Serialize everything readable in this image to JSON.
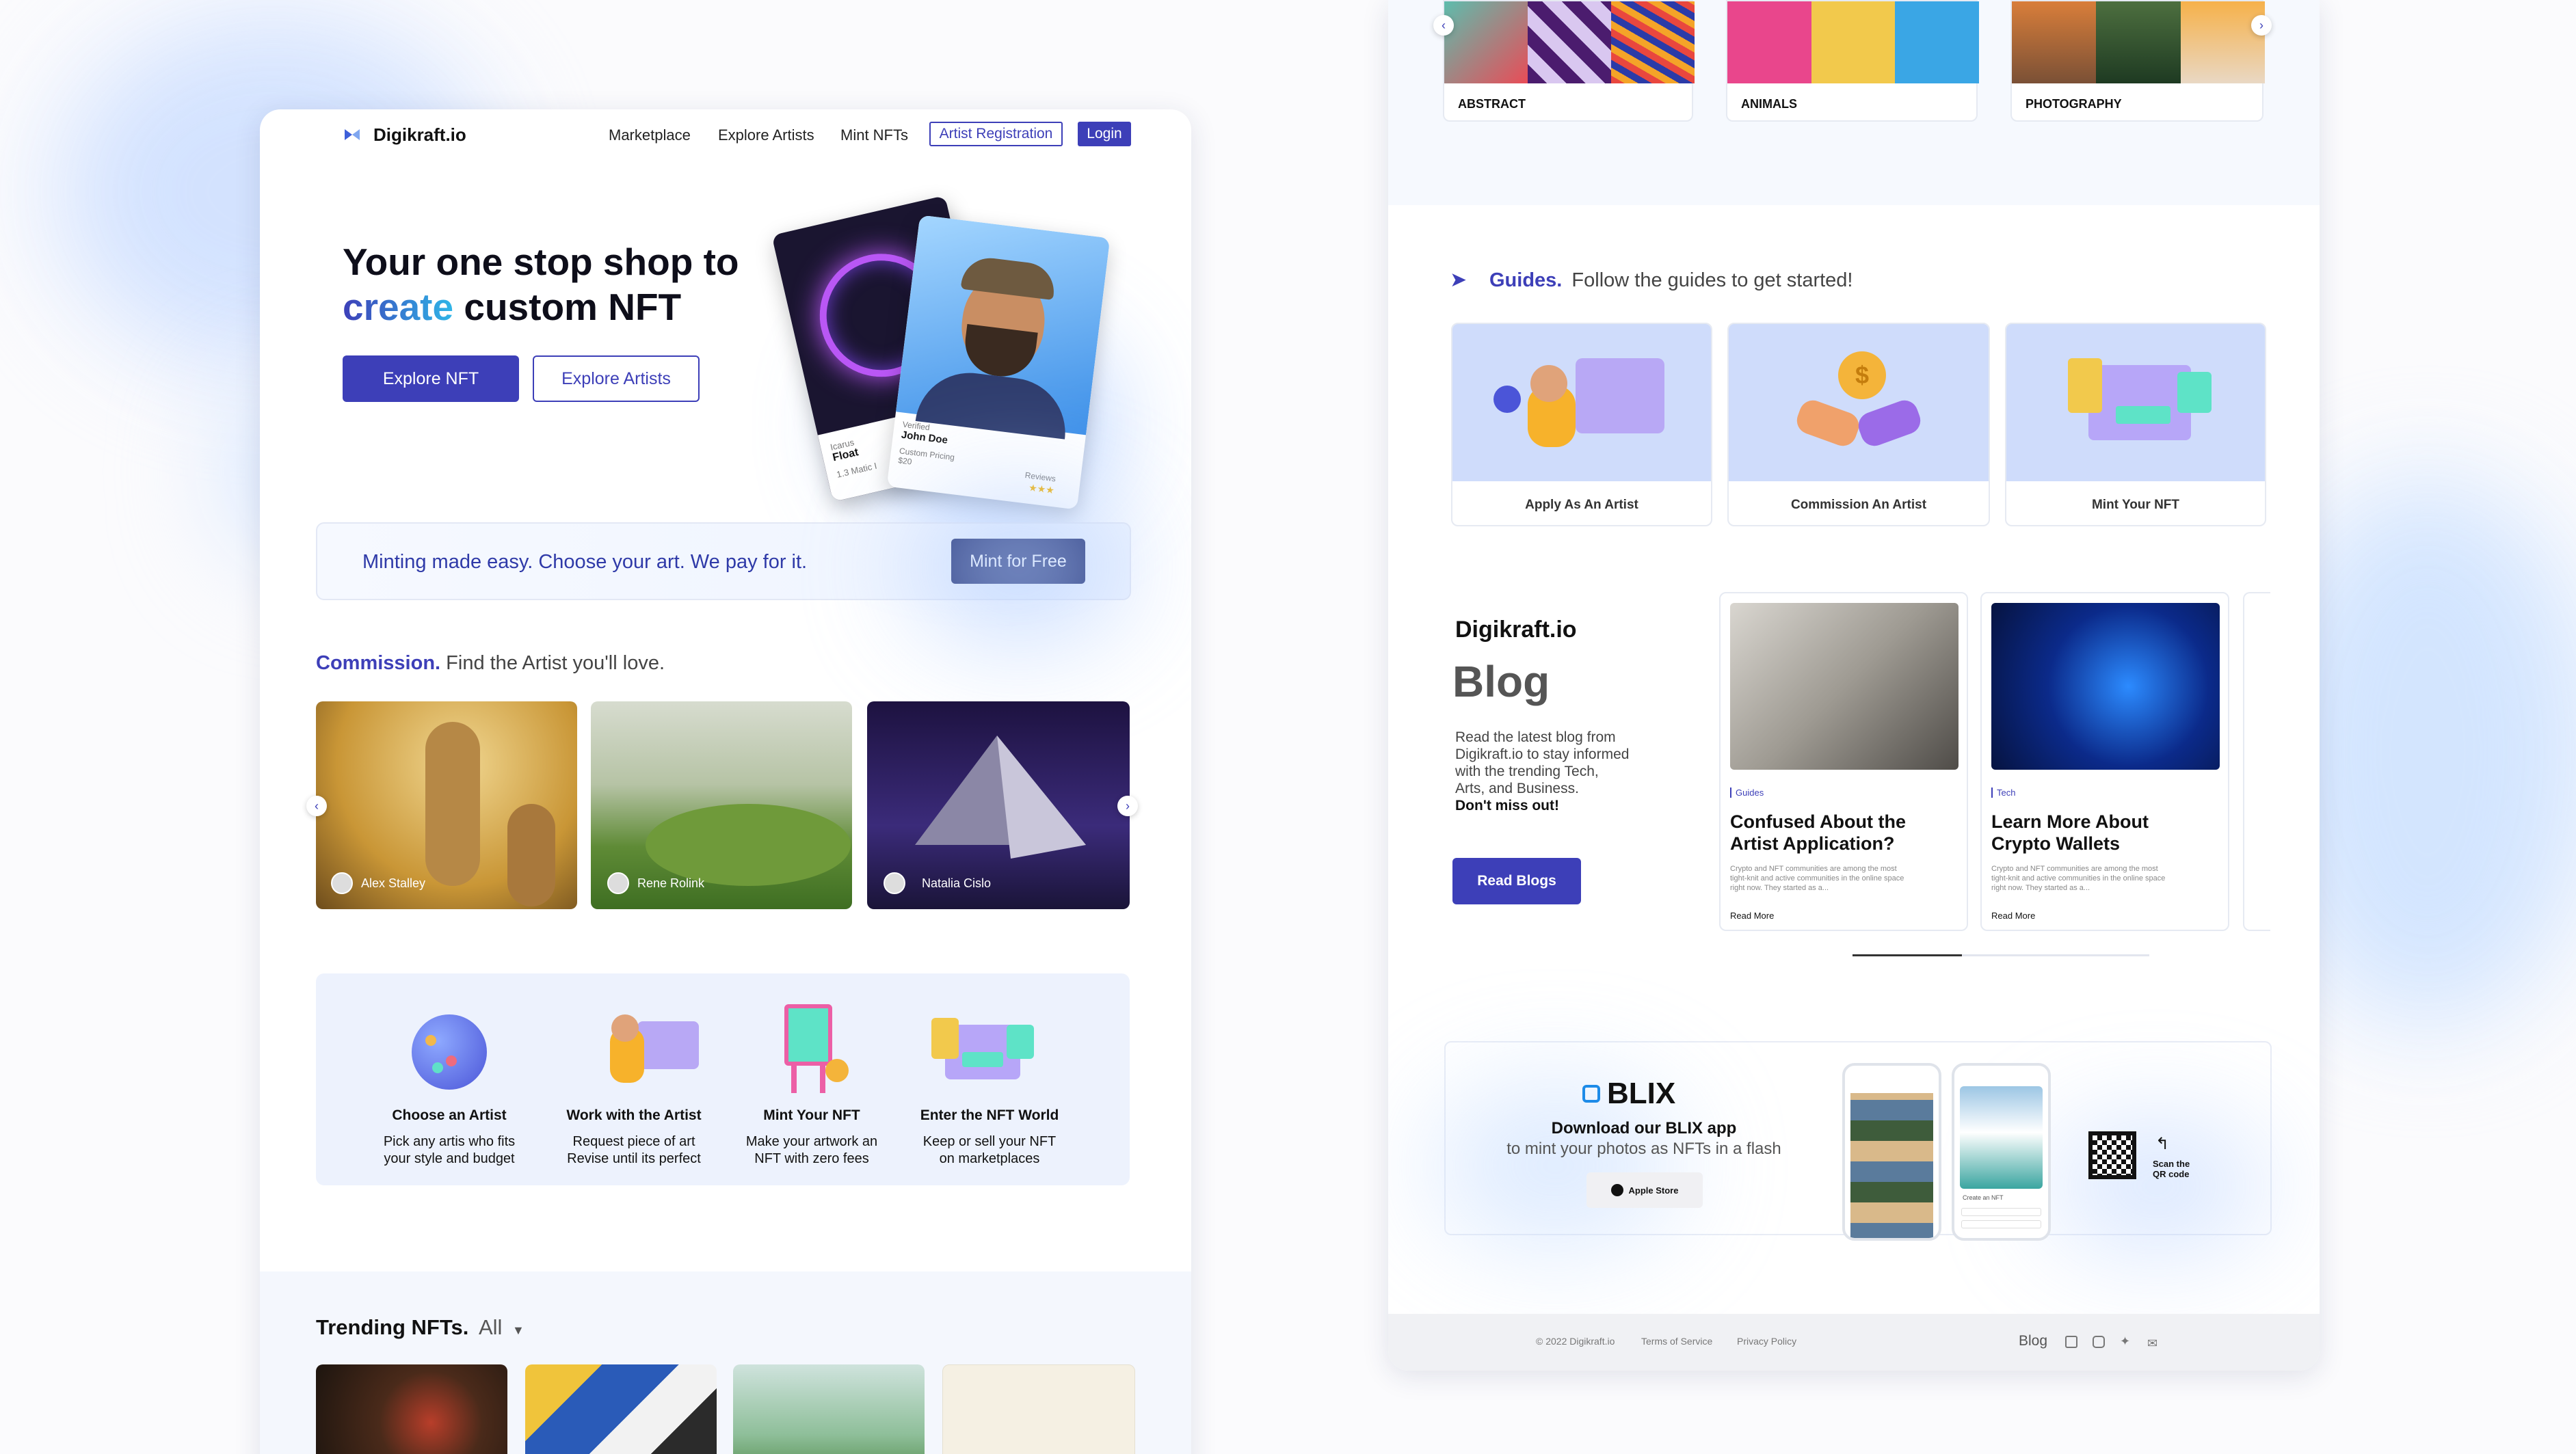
{
  "left": {
    "brand": "Digikraft.io",
    "nav": {
      "marketplace": "Marketplace",
      "explore_artists": "Explore Artists",
      "mint_nfts": "Mint NFTs",
      "artist_registration": "Artist Registration",
      "login": "Login"
    },
    "hero": {
      "line1": "Your one stop shop to",
      "highlight": "create",
      "line2": "custom NFT",
      "explore_nft": "Explore NFT",
      "explore_artists": "Explore Artists"
    },
    "nft_card_a": {
      "small": "Icarus",
      "name": "Float",
      "price": "1.3 Matic I"
    },
    "nft_card_b": {
      "small": "Verified",
      "name": "John Doe",
      "pricing_label": "Custom Pricing",
      "pricing_value": "$20",
      "reviews": "Reviews"
    },
    "mint_banner": {
      "text": "Minting made easy. Choose your art. We pay for it.",
      "button": "Mint for Free"
    },
    "commission": {
      "title": "Commission.",
      "subtitle": "Find the Artist you'll love.",
      "artists": [
        "Alex Stalley",
        "Rene Rolink",
        "Natalia Cislo"
      ]
    },
    "steps": [
      {
        "title": "Choose an Artist",
        "line1": "Pick any artis who fits",
        "line2": "your style and budget"
      },
      {
        "title": "Work with the Artist",
        "line1": "Request piece of art",
        "line2": "Revise until its perfect"
      },
      {
        "title": "Mint Your NFT",
        "line1": "Make your artwork an",
        "line2": "NFT with zero fees"
      },
      {
        "title": "Enter the NFT World",
        "line1": "Keep or sell your NFT",
        "line2": "on marketplaces"
      }
    ],
    "trending": {
      "title": "Trending NFTs.",
      "filter": "All"
    }
  },
  "right": {
    "categories": [
      "ABSTRACT",
      "ANIMALS",
      "PHOTOGRAPHY"
    ],
    "guides": {
      "title": "Guides.",
      "subtitle": "Follow the guides to get started!",
      "items": [
        "Apply As An Artist",
        "Commission An Artist",
        "Mint Your NFT"
      ]
    },
    "blog": {
      "brand": "Digikraft.io",
      "title": "Blog",
      "desc1": "Read the latest blog from",
      "desc2": "Digikraft.io to stay informed",
      "desc3": "with the trending Tech,",
      "desc4": "Arts, and Business.",
      "emph": "Don't miss out!",
      "button": "Read Blogs",
      "posts": [
        {
          "tag": "Guides",
          "title1": "Confused About the",
          "title2": "Artist Application?",
          "body1": "Crypto and NFT communities are among the most",
          "body2": "tight-knit and active communities in the online space",
          "body3": "right now. They started as a...",
          "more": "Read More"
        },
        {
          "tag": "Tech",
          "title1": "Learn More About",
          "title2": "Crypto Wallets",
          "body1": "Crypto and NFT communities are among the most",
          "body2": "tight-knit and active communities in the online space",
          "body3": "right now. They started as a...",
          "more": "Read More"
        }
      ]
    },
    "app": {
      "brand": "BLIX",
      "headline": "Download our BLIX app",
      "sub": "to mint your photos as NFTs in a flash",
      "store": "Apple Store",
      "scan1": "Scan the",
      "scan2": "QR code",
      "phone_label": "Create an NFT"
    },
    "footer": {
      "copyright": "© 2022 Digikraft.io",
      "terms": "Terms of Service",
      "privacy": "Privacy Policy",
      "blog": "Blog"
    }
  },
  "colors": {
    "primary": "#3d3fb8",
    "navy": "#16246a",
    "accent": "#2fb6e8",
    "panel": "#edf2fd"
  }
}
